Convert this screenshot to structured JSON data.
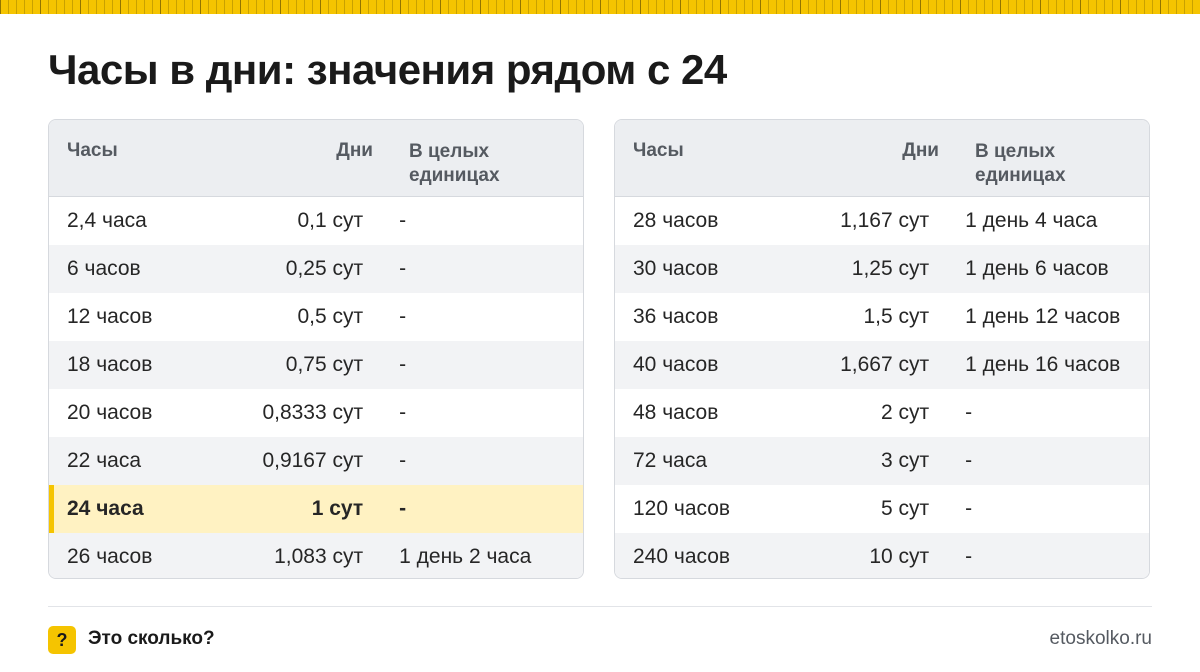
{
  "title": "Часы в дни: значения рядом с 24",
  "columns": {
    "hours": "Часы",
    "days": "Дни",
    "whole_line1": "В целых",
    "whole_line2": "единицах"
  },
  "left_rows": [
    {
      "hours": "2,4 часа",
      "days": "0,1 сут",
      "whole": "-"
    },
    {
      "hours": "6 часов",
      "days": "0,25 сут",
      "whole": "-"
    },
    {
      "hours": "12 часов",
      "days": "0,5 сут",
      "whole": "-"
    },
    {
      "hours": "18 часов",
      "days": "0,75 сут",
      "whole": "-"
    },
    {
      "hours": "20 часов",
      "days": "0,8333 сут",
      "whole": "-"
    },
    {
      "hours": "22 часа",
      "days": "0,9167 сут",
      "whole": "-"
    },
    {
      "hours": "24 часа",
      "days": "1 сут",
      "whole": "-"
    },
    {
      "hours": "26 часов",
      "days": "1,083 сут",
      "whole": "1 день 2 часа"
    }
  ],
  "right_rows": [
    {
      "hours": "28 часов",
      "days": "1,167 сут",
      "whole": "1 день 4 часа"
    },
    {
      "hours": "30 часов",
      "days": "1,25 сут",
      "whole": "1 день 6 часов"
    },
    {
      "hours": "36 часов",
      "days": "1,5 сут",
      "whole": "1 день 12 часов"
    },
    {
      "hours": "40 часов",
      "days": "1,667 сут",
      "whole": "1 день 16 часов"
    },
    {
      "hours": "48 часов",
      "days": "2 сут",
      "whole": "-"
    },
    {
      "hours": "72 часа",
      "days": "3 сут",
      "whole": "-"
    },
    {
      "hours": "120 часов",
      "days": "5 сут",
      "whole": "-"
    },
    {
      "hours": "240 часов",
      "days": "10 сут",
      "whole": "-"
    }
  ],
  "footer": {
    "badge": "?",
    "brand": "Это сколько?",
    "site": "etoskolko.ru"
  },
  "colors": {
    "accent": "#f5c400",
    "highlight_row": "#fff2c2",
    "header_bg": "#eceef1"
  }
}
